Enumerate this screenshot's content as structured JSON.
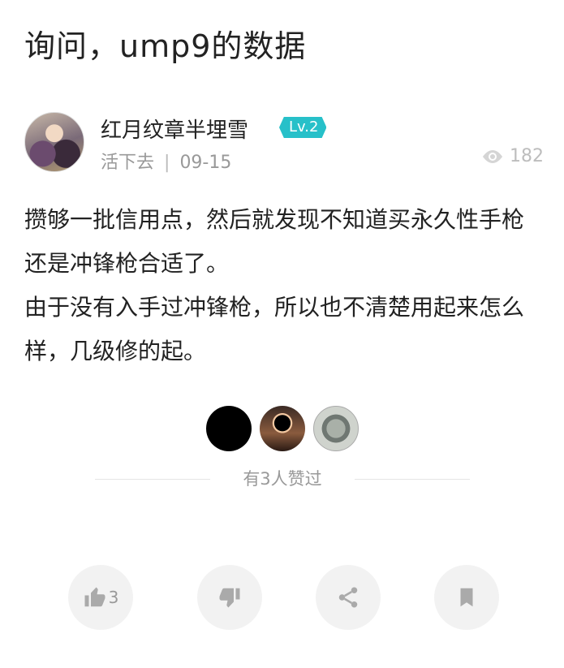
{
  "post": {
    "title": "询问，ump9的数据",
    "author": {
      "name": "红月纹章半埋雪",
      "level": "Lv.2",
      "signature": "活下去",
      "separator": "|",
      "date": "09-15"
    },
    "views": "182",
    "content": [
      "攒够一批信用点，然后就发现不知道买永久性手枪还是冲锋枪合适了。",
      "由于没有入手过冲锋枪，所以也不清楚用起来怎么样，几级修的起。"
    ],
    "likers_label": "有3人赞过"
  },
  "actions": {
    "like_count": "3"
  },
  "colors": {
    "level_badge": "#27c0c9",
    "muted_text": "#999999",
    "action_bg": "#f2f2f2"
  }
}
